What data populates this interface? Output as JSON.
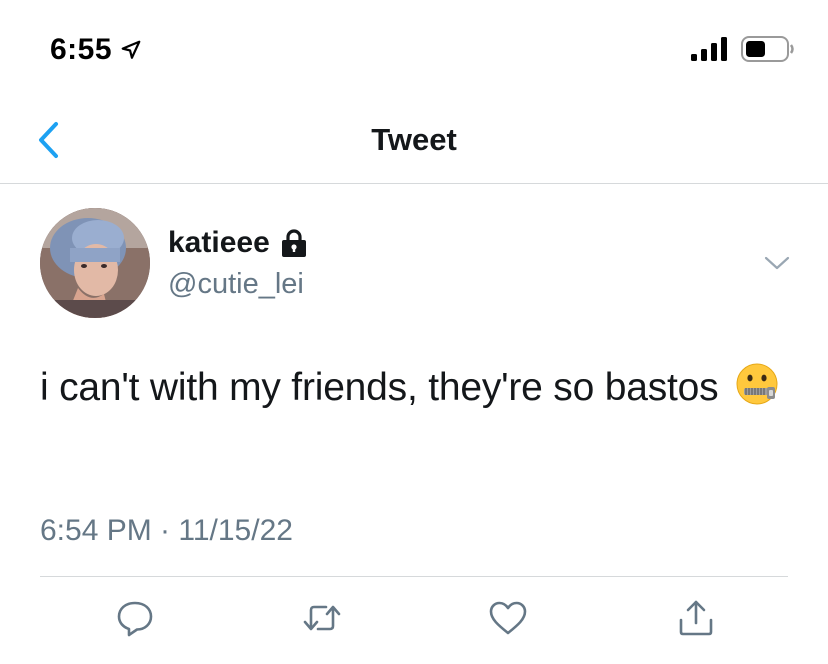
{
  "status_bar": {
    "time": "6:55",
    "icons": [
      "location-arrow-icon",
      "signal-icon",
      "battery-icon"
    ]
  },
  "nav": {
    "back_icon": "chevron-left-icon",
    "title": "Tweet"
  },
  "tweet": {
    "author": {
      "display_name": "katieee",
      "handle": "@cutie_lei",
      "protected_icon": "lock-icon"
    },
    "text": "i can't with my friends, they're so bastos",
    "emoji": "zipper-mouth-face",
    "timestamp": "6:54 PM · 11/15/22",
    "menu_icon": "chevron-down-icon",
    "actions": [
      "reply-icon",
      "retweet-icon",
      "like-icon",
      "share-icon"
    ]
  },
  "colors": {
    "accent": "#1da1f2",
    "text": "#14171a",
    "secondary": "#657786",
    "divider": "#d6d9db"
  }
}
